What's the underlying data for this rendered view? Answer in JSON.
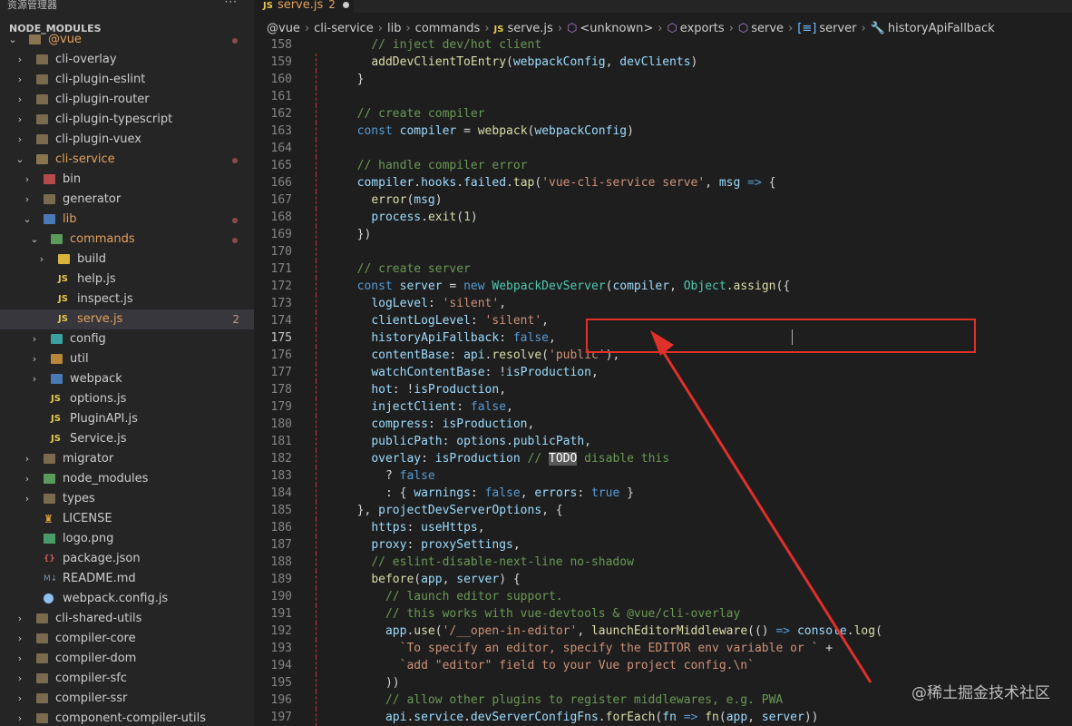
{
  "sidebar": {
    "title": "资源管理器",
    "more": "···",
    "section": "NODE_MODULES",
    "items": [
      {
        "label": "@vue",
        "chev": "⌄",
        "depth": 0,
        "icon": "folder-open",
        "dot": true,
        "color": "c-orange"
      },
      {
        "label": "cli-overlay",
        "chev": "›",
        "depth": 1,
        "icon": "folder"
      },
      {
        "label": "cli-plugin-eslint",
        "chev": "›",
        "depth": 1,
        "icon": "folder"
      },
      {
        "label": "cli-plugin-router",
        "chev": "›",
        "depth": 1,
        "icon": "folder"
      },
      {
        "label": "cli-plugin-typescript",
        "chev": "›",
        "depth": 1,
        "icon": "folder"
      },
      {
        "label": "cli-plugin-vuex",
        "chev": "›",
        "depth": 1,
        "icon": "folder"
      },
      {
        "label": "cli-service",
        "chev": "⌄",
        "depth": 1,
        "icon": "folder-open",
        "dot": true,
        "color": "c-orange"
      },
      {
        "label": "bin",
        "chev": "›",
        "depth": 2,
        "icon": "folder-red"
      },
      {
        "label": "generator",
        "chev": "›",
        "depth": 2,
        "icon": "folder"
      },
      {
        "label": "lib",
        "chev": "⌄",
        "depth": 2,
        "icon": "folder-blue",
        "dot": true,
        "color": "c-orange"
      },
      {
        "label": "commands",
        "chev": "⌄",
        "depth": 3,
        "icon": "folder-green",
        "dot": true,
        "color": "c-orange"
      },
      {
        "label": "build",
        "chev": "›",
        "depth": 4,
        "icon": "folder-yellow"
      },
      {
        "label": "help.js",
        "chev": "",
        "depth": 4,
        "icon": "js"
      },
      {
        "label": "inspect.js",
        "chev": "",
        "depth": 4,
        "icon": "js"
      },
      {
        "label": "serve.js",
        "chev": "",
        "depth": 4,
        "icon": "js",
        "active": true,
        "count": "2",
        "color": "c-orange"
      },
      {
        "label": "config",
        "chev": "›",
        "depth": 3,
        "icon": "folder-teal"
      },
      {
        "label": "util",
        "chev": "›",
        "depth": 3,
        "icon": "folder-orange"
      },
      {
        "label": "webpack",
        "chev": "›",
        "depth": 3,
        "icon": "folder-blue"
      },
      {
        "label": "options.js",
        "chev": "",
        "depth": 3,
        "icon": "js"
      },
      {
        "label": "PluginAPI.js",
        "chev": "",
        "depth": 3,
        "icon": "js"
      },
      {
        "label": "Service.js",
        "chev": "",
        "depth": 3,
        "icon": "js"
      },
      {
        "label": "migrator",
        "chev": "›",
        "depth": 2,
        "icon": "folder"
      },
      {
        "label": "node_modules",
        "chev": "›",
        "depth": 2,
        "icon": "folder-green"
      },
      {
        "label": "types",
        "chev": "›",
        "depth": 2,
        "icon": "folder"
      },
      {
        "label": "LICENSE",
        "chev": "",
        "depth": 2,
        "icon": "license"
      },
      {
        "label": "logo.png",
        "chev": "",
        "depth": 2,
        "icon": "png"
      },
      {
        "label": "package.json",
        "chev": "",
        "depth": 2,
        "icon": "json"
      },
      {
        "label": "README.md",
        "chev": "",
        "depth": 2,
        "icon": "md"
      },
      {
        "label": "webpack.config.js",
        "chev": "",
        "depth": 2,
        "icon": "webpack"
      },
      {
        "label": "cli-shared-utils",
        "chev": "›",
        "depth": 1,
        "icon": "folder"
      },
      {
        "label": "compiler-core",
        "chev": "›",
        "depth": 1,
        "icon": "folder"
      },
      {
        "label": "compiler-dom",
        "chev": "›",
        "depth": 1,
        "icon": "folder"
      },
      {
        "label": "compiler-sfc",
        "chev": "›",
        "depth": 1,
        "icon": "folder"
      },
      {
        "label": "compiler-ssr",
        "chev": "›",
        "depth": 1,
        "icon": "folder"
      },
      {
        "label": "component-compiler-utils",
        "chev": "›",
        "depth": 1,
        "icon": "folder"
      }
    ]
  },
  "tab": {
    "icon": "JS",
    "label": "serve.js",
    "problems": "2"
  },
  "breadcrumb": [
    "@vue",
    "cli-service",
    "lib",
    "commands",
    "serve.js",
    "<unknown>",
    "exports",
    "serve",
    "server",
    "historyApiFallback"
  ],
  "code": {
    "current_line": 175,
    "lines": [
      {
        "n": 158,
        "html": "<span class='c'>// inject dev/hot client</span>",
        "indent": "    "
      },
      {
        "n": 159,
        "html": "<span class='f'>addDevClientToEntry</span>(<span class='v'>webpackConfig</span>, <span class='v'>devClients</span>)",
        "indent": "    "
      },
      {
        "n": 160,
        "html": "}",
        "indent": "  "
      },
      {
        "n": 161,
        "html": "",
        "indent": ""
      },
      {
        "n": 162,
        "html": "<span class='c'>// create compiler</span>",
        "indent": "  "
      },
      {
        "n": 163,
        "html": "<span class='k'>const</span> <span class='v'>compiler</span> = <span class='f'>webpack</span>(<span class='v'>webpackConfig</span>)",
        "indent": "  "
      },
      {
        "n": 164,
        "html": "",
        "indent": ""
      },
      {
        "n": 165,
        "html": "<span class='c'>// handle compiler error</span>",
        "indent": "  "
      },
      {
        "n": 166,
        "html": "<span class='v'>compiler</span>.<span class='v'>hooks</span>.<span class='v'>failed</span>.<span class='f'>tap</span>(<span class='s'>'vue-cli-service serve'</span>, <span class='v'>msg</span> <span class='k'>=&gt;</span> {",
        "indent": "  "
      },
      {
        "n": 167,
        "html": "<span class='f'>error</span>(<span class='v'>msg</span>)",
        "indent": "    "
      },
      {
        "n": 168,
        "html": "<span class='v'>process</span>.<span class='f'>exit</span>(<span class='n'>1</span>)",
        "indent": "    "
      },
      {
        "n": 169,
        "html": "})",
        "indent": "  "
      },
      {
        "n": 170,
        "html": "",
        "indent": ""
      },
      {
        "n": 171,
        "html": "<span class='c'>// create server</span>",
        "indent": "  "
      },
      {
        "n": 172,
        "html": "<span class='k'>const</span> <span class='v'>server</span> = <span class='k'>new</span> <span class='cls'>WebpackDevServer</span>(<span class='v'>compiler</span>, <span class='cls'>Object</span>.<span class='f'>assign</span>({",
        "indent": "  "
      },
      {
        "n": 173,
        "html": "<span class='v'>logLevel</span>: <span class='s'>'silent'</span>,",
        "indent": "    "
      },
      {
        "n": 174,
        "html": "<span class='v'>clientLogLevel</span>: <span class='s'>'silent'</span>,",
        "indent": "    "
      },
      {
        "n": 175,
        "html": "<span class='v'>historyApiFallback</span>: <span class='k'>false</span>,",
        "indent": "    "
      },
      {
        "n": 176,
        "html": "<span class='v'>contentBase</span>: <span class='v'>api</span>.<span class='f'>resolve</span>(<span class='s'>'public'</span>),",
        "indent": "    "
      },
      {
        "n": 177,
        "html": "<span class='v'>watchContentBase</span>: !<span class='v'>isProduction</span>,",
        "indent": "    "
      },
      {
        "n": 178,
        "html": "<span class='v'>hot</span>: !<span class='v'>isProduction</span>,",
        "indent": "    "
      },
      {
        "n": 179,
        "html": "<span class='v'>injectClient</span>: <span class='k'>false</span>,",
        "indent": "    "
      },
      {
        "n": 180,
        "html": "<span class='v'>compress</span>: <span class='v'>isProduction</span>,",
        "indent": "    "
      },
      {
        "n": 181,
        "html": "<span class='v'>publicPath</span>: <span class='v'>options</span>.<span class='v'>publicPath</span>,",
        "indent": "    "
      },
      {
        "n": 182,
        "html": "<span class='v'>overlay</span>: <span class='v'>isProduction</span> <span class='c'>// <span class='todo'>TODO</span> disable this</span>",
        "indent": "    "
      },
      {
        "n": 183,
        "html": "? <span class='k'>false</span>",
        "indent": "      "
      },
      {
        "n": 184,
        "html": ": { <span class='v'>warnings</span>: <span class='k'>false</span>, <span class='v'>errors</span>: <span class='k'>true</span> }",
        "indent": "      "
      },
      {
        "n": 185,
        "html": "}, <span class='v'>projectDevServerOptions</span>, {",
        "indent": "  "
      },
      {
        "n": 186,
        "html": "<span class='v'>https</span>: <span class='v'>useHttps</span>,",
        "indent": "    "
      },
      {
        "n": 187,
        "html": "<span class='v'>proxy</span>: <span class='v'>proxySettings</span>,",
        "indent": "    "
      },
      {
        "n": 188,
        "html": "<span class='c'>// eslint-disable-next-line no-shadow</span>",
        "indent": "    "
      },
      {
        "n": 189,
        "html": "<span class='f'>before</span>(<span class='v'>app</span>, <span class='v'>server</span>) {",
        "indent": "    "
      },
      {
        "n": 190,
        "html": "<span class='c'>// launch editor support.</span>",
        "indent": "      "
      },
      {
        "n": 191,
        "html": "<span class='c'>// this works with vue-devtools &amp; @vue/cli-overlay</span>",
        "indent": "      "
      },
      {
        "n": 192,
        "html": "<span class='v'>app</span>.<span class='f'>use</span>(<span class='s'>'/__open-in-editor'</span>, <span class='f'>launchEditorMiddleware</span>(() <span class='k'>=&gt;</span> <span class='v'>console</span>.<span class='f'>log</span>(",
        "indent": "      "
      },
      {
        "n": 193,
        "html": "<span class='s'>`To specify an editor, specify the EDITOR env variable or `</span> +",
        "indent": "        "
      },
      {
        "n": 194,
        "html": "<span class='s'>`add \"editor\" field to your Vue project config.\\n`</span>",
        "indent": "        "
      },
      {
        "n": 195,
        "html": "))",
        "indent": "      "
      },
      {
        "n": 196,
        "html": "<span class='c'>// allow other plugins to register middlewares, e.g. PWA</span>",
        "indent": "      "
      },
      {
        "n": 197,
        "html": "<span class='v'>api</span>.<span class='v'>service</span>.<span class='v'>devServerConfigFns</span>.<span class='f'>forEach</span>(<span class='v'>fn</span> <span class='k'>=&gt;</span> <span class='f'>fn</span>(<span class='v'>app</span>, <span class='v'>server</span>))",
        "indent": "      "
      }
    ]
  },
  "watermark": "@稀土掘金技术社区",
  "colors": {
    "annotation": "#e0302a",
    "accent": "#e2a15a"
  }
}
